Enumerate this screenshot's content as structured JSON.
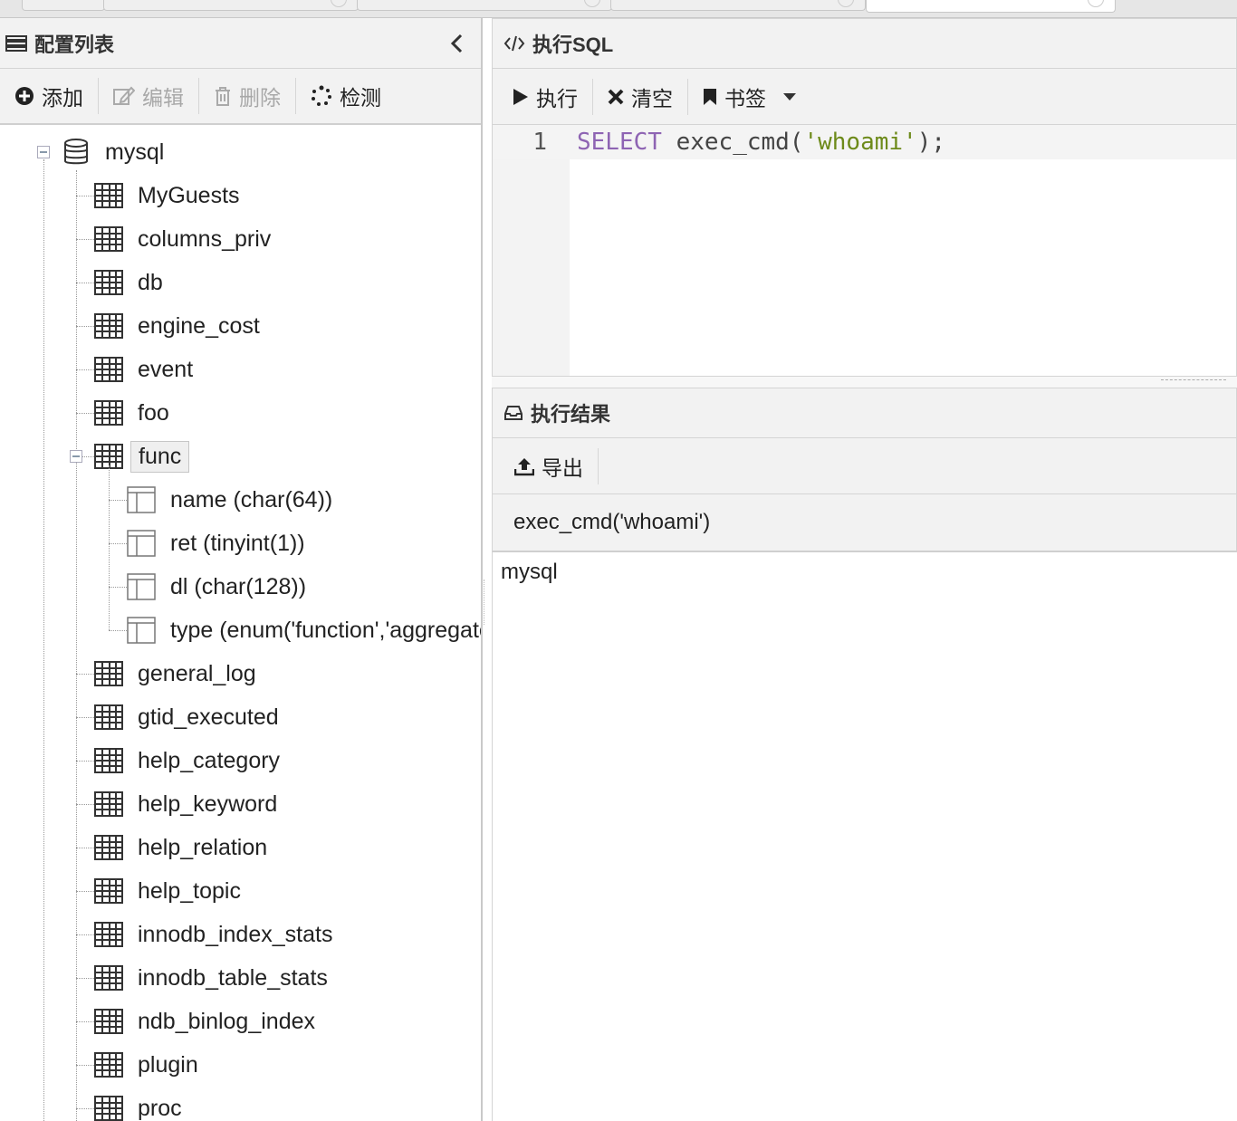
{
  "left_panel": {
    "title": "配置列表",
    "toolbar": {
      "add": "添加",
      "edit": "编辑",
      "delete": "删除",
      "detect": "检测"
    },
    "tree": {
      "root": "mysql",
      "tables": [
        "MyGuests",
        "columns_priv",
        "db",
        "engine_cost",
        "event",
        "foo",
        "func",
        "general_log",
        "gtid_executed",
        "help_category",
        "help_keyword",
        "help_relation",
        "help_topic",
        "innodb_index_stats",
        "innodb_table_stats",
        "ndb_binlog_index",
        "plugin",
        "proc"
      ],
      "selected_table": "func",
      "func_columns": [
        "name (char(64))",
        "ret (tinyint(1))",
        "dl (char(128))",
        "type (enum('function','aggregate'))"
      ]
    }
  },
  "sql_panel": {
    "title": "执行SQL",
    "toolbar": {
      "run": "执行",
      "clear": "清空",
      "bookmark": "书签"
    },
    "editor": {
      "line_number": "1",
      "keyword": "SELECT",
      "func": " exec_cmd(",
      "string": "'whoami'",
      "tail": ");"
    }
  },
  "result_panel": {
    "title": "执行结果",
    "toolbar": {
      "export": "导出"
    },
    "columns": [
      "exec_cmd('whoami')"
    ],
    "rows": [
      [
        "mysql"
      ]
    ]
  }
}
